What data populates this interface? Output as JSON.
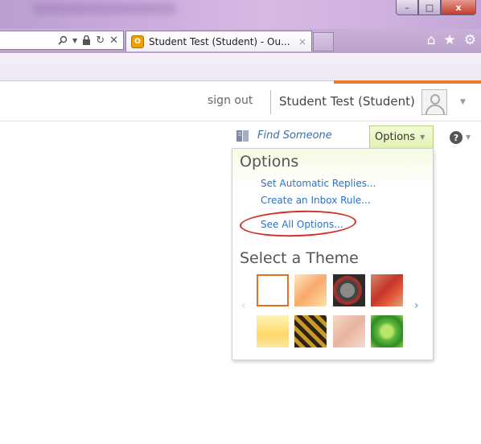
{
  "browser": {
    "window_buttons": {
      "minimize": "–",
      "maximize": "□",
      "close": "x"
    },
    "address_icons": [
      "search-icon",
      "dropdown-icon",
      "lock-icon",
      "refresh-icon",
      "stop-icon"
    ],
    "tab": {
      "title": "Student Test (Student) - Ou...",
      "close": "×",
      "favicon_letter": "O"
    },
    "right_icons": [
      "home-icon",
      "star-icon",
      "gear-icon"
    ]
  },
  "header": {
    "sign_out": "sign out",
    "user_name": "Student Test (Student)",
    "find_someone": "Find Someone",
    "options_label": "Options",
    "help_glyph": "?"
  },
  "options_menu": {
    "title": "Options",
    "links": [
      "Set Automatic Replies...",
      "Create an Inbox Rule...",
      "See All Options..."
    ],
    "highlighted_link_index": 2,
    "highlight_color": "#d0302a",
    "theme_title": "Select a Theme",
    "themes": [
      "blank",
      "sunset",
      "robot",
      "red-leaves",
      "yellow",
      "bee-stripes",
      "pink-petals",
      "green-leaf"
    ],
    "selected_theme_index": 0
  },
  "colors": {
    "accent_orange": "#f07a24",
    "link_blue": "#2a72c6",
    "options_green": "#e1f1b0"
  }
}
